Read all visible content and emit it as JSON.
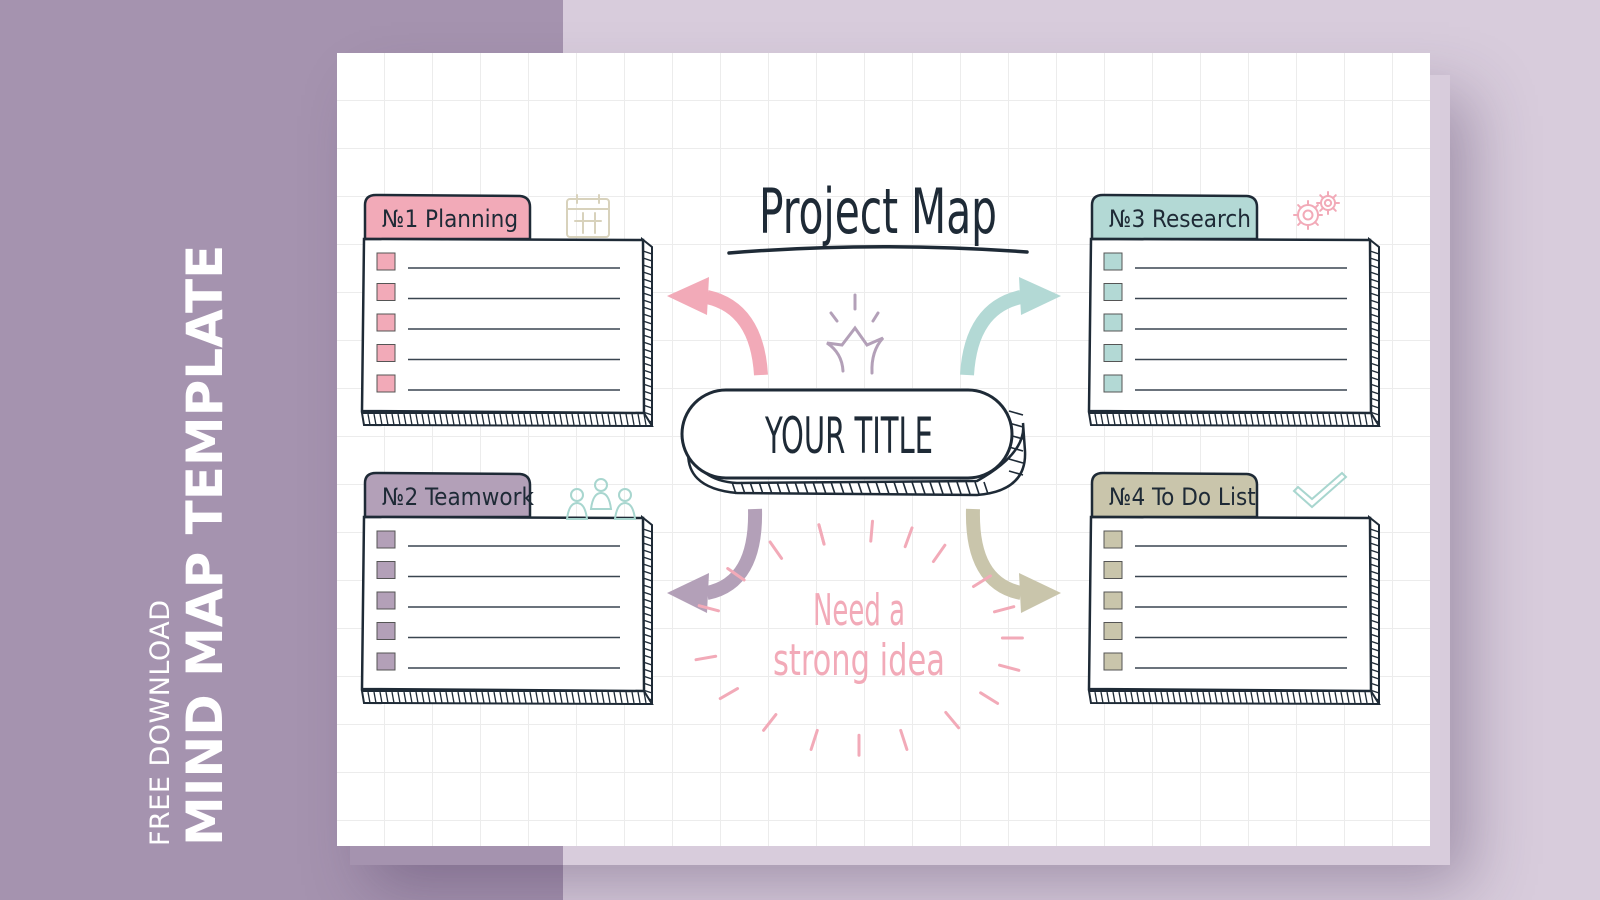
{
  "side_banner": {
    "subtitle": "FREE DOWNLOAD",
    "title": "MIND MAP TEMPLATE",
    "background": "#a593af"
  },
  "page_background": "#d8ccdc",
  "template": {
    "heading": "Project Map",
    "central_node": "YOUR TITLE",
    "callout": {
      "line1": "Need a",
      "line2": "strong idea",
      "color": "#f2aab8"
    },
    "cards": [
      {
        "id": "planning",
        "number": "№1",
        "label": "Planning",
        "color": "#f2aab8",
        "icon": "calendar-icon",
        "icon_color": "#d8d2bc",
        "item_count": 5
      },
      {
        "id": "teamwork",
        "number": "№2",
        "label": "Teamwork",
        "color": "#b3a0b8",
        "icon": "team-icon",
        "icon_color": "#a8d6cf",
        "item_count": 5
      },
      {
        "id": "research",
        "number": "№3",
        "label": "Research",
        "color": "#b3d9d5",
        "icon": "gears-icon",
        "icon_color": "#f2aab8",
        "item_count": 5
      },
      {
        "id": "todo",
        "number": "№4",
        "label": "To Do List",
        "color": "#c9c5ab",
        "icon": "checkmark-icon",
        "icon_color": "#a8d6cf",
        "item_count": 5
      }
    ],
    "arrows": [
      {
        "to": "planning",
        "color": "#f2aab8"
      },
      {
        "to": "research",
        "color": "#b3d9d5"
      },
      {
        "to": "teamwork",
        "color": "#b3a0b8"
      },
      {
        "to": "todo",
        "color": "#c9c5ab"
      }
    ],
    "ink_color": "#1e2a36"
  }
}
